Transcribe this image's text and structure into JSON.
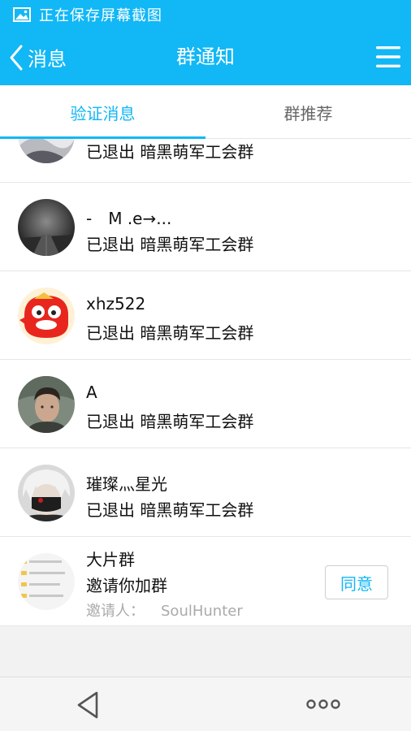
{
  "status_bar": {
    "icon": "image-icon",
    "text": "正在保存屏幕截图"
  },
  "header": {
    "back_label": "消息",
    "title": "群通知",
    "menu_icon": "hamburger-menu-icon"
  },
  "tabs": [
    {
      "label": "验证消息",
      "active": true
    },
    {
      "label": "群推荐",
      "active": false
    }
  ],
  "notifications": [
    {
      "name": "",
      "message": "已退出 暗黑萌军工会群",
      "avatar": "photo-avatar-partial"
    },
    {
      "name": "-　M .e→...",
      "message": "已退出 暗黑萌军工会群",
      "avatar": "dark-bridge-avatar"
    },
    {
      "name": "xhz522",
      "message": "已退出 暗黑萌军工会群",
      "avatar": "red-cartoon-avatar"
    },
    {
      "name": "A",
      "message": "已退出 暗黑萌军工会群",
      "avatar": "man-portrait-avatar"
    },
    {
      "name": "璀璨灬星光",
      "message": "已退出 暗黑萌军工会群",
      "avatar": "anime-character-avatar"
    },
    {
      "name": "大片群",
      "message": "邀请你加群",
      "inviter_label": "邀请人：",
      "inviter_name": "SoulHunter",
      "action_label": "同意",
      "avatar": "group-avatar"
    }
  ],
  "bottom_nav": {
    "back_icon": "triangle-back-icon",
    "more_icon": "three-dots-icon"
  },
  "colors": {
    "accent": "#12b7f5",
    "background": "#f2f2f2"
  }
}
